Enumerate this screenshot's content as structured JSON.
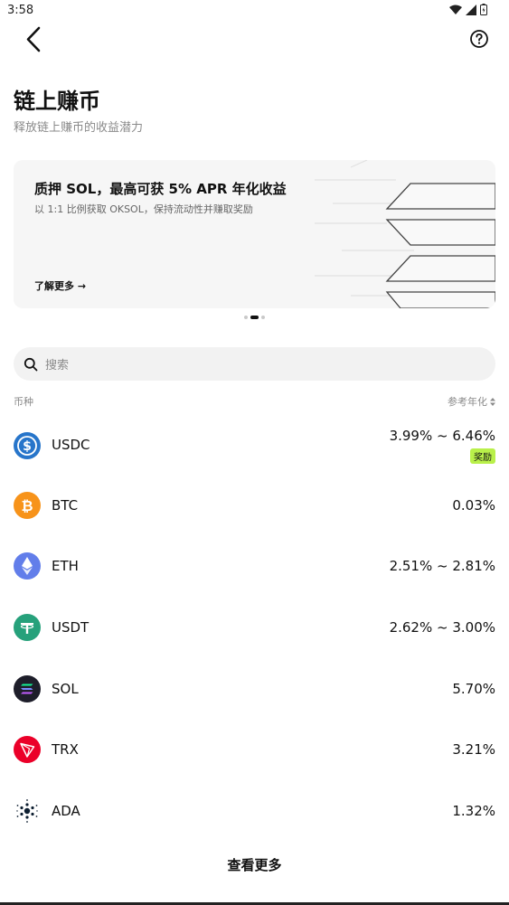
{
  "status_bar": {
    "time": "3:58"
  },
  "header": {
    "title": "链上赚币",
    "subtitle": "释放链上赚币的收益潜力"
  },
  "banner": {
    "title": "质押 SOL，最高可获 5% APR 年化收益",
    "description": "以 1:1 比例获取 OKSOL，保持流动性并赚取奖励",
    "link_label": "了解更多 →"
  },
  "search": {
    "placeholder": "搜索"
  },
  "list_header": {
    "left": "币种",
    "right": "参考年化"
  },
  "coins": [
    {
      "name": "USDC",
      "apr": "3.99% ~ 6.46%",
      "badge": "奖励",
      "icon": "usdc-icon",
      "color": "#2775ca"
    },
    {
      "name": "BTC",
      "apr": "0.03%",
      "icon": "btc-icon",
      "color": "#f7931a"
    },
    {
      "name": "ETH",
      "apr": "2.51% ~ 2.81%",
      "icon": "eth-icon",
      "color": "#627eea"
    },
    {
      "name": "USDT",
      "apr": "2.62% ~ 3.00%",
      "icon": "usdt-icon",
      "color": "#26a17b"
    },
    {
      "name": "SOL",
      "apr": "5.70%",
      "icon": "sol-icon",
      "color": "#1e1e2a"
    },
    {
      "name": "TRX",
      "apr": "3.21%",
      "icon": "trx-icon",
      "color": "#eb0029"
    },
    {
      "name": "ADA",
      "apr": "1.32%",
      "icon": "ada-icon",
      "color": "#0d1e30"
    }
  ],
  "more_label": "查看更多",
  "colors": {
    "badge": "#b9f04a",
    "banner_bg": "#f6f6f6",
    "search_bg": "#f2f2f2"
  }
}
